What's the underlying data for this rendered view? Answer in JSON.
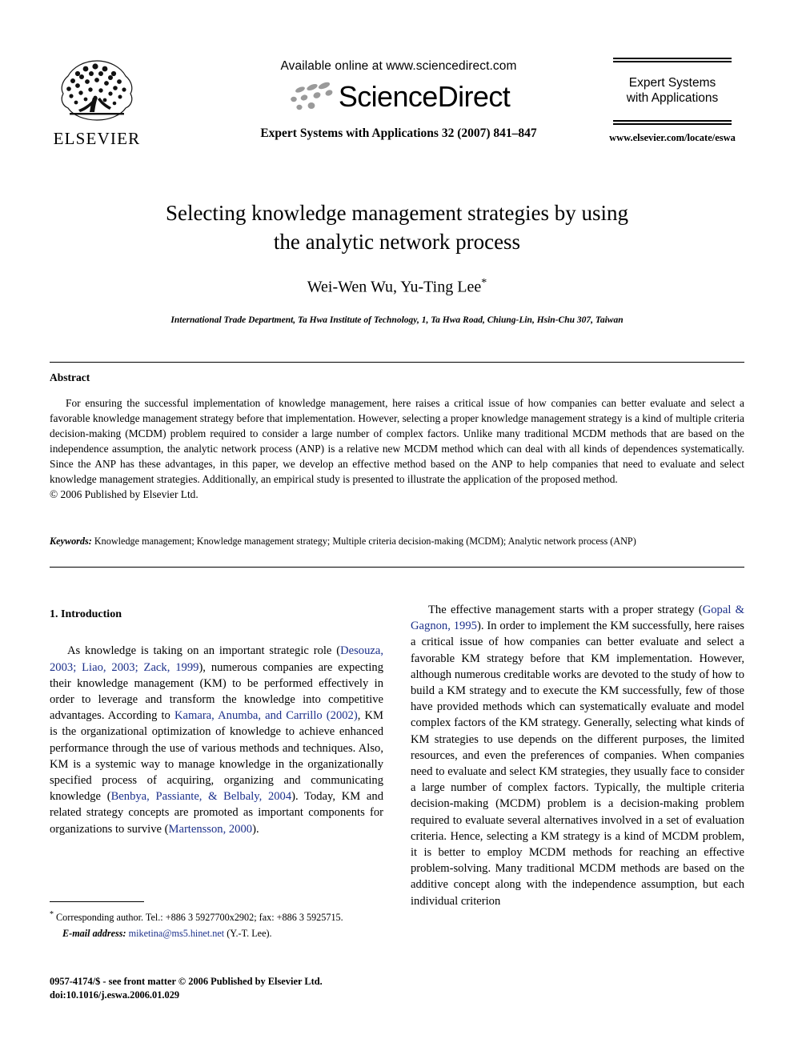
{
  "masthead": {
    "publisher_name": "ELSEVIER",
    "available_online": "Available online at www.sciencedirect.com",
    "sciencedirect_wordmark": "ScienceDirect",
    "journal_reference": "Expert Systems with Applications 32 (2007) 841–847",
    "journal_box": {
      "name_line1": "Expert Systems",
      "name_line2": "with Applications",
      "url": "www.elsevier.com/locate/eswa"
    }
  },
  "title_block": {
    "title_line1": "Selecting knowledge management strategies by using",
    "title_line2": "the analytic network process",
    "authors": "Wei-Wen Wu, Yu-Ting Lee",
    "corresponding_marker": "*",
    "affiliation": "International Trade Department, Ta Hwa Institute of Technology, 1, Ta Hwa Road, Chiung-Lin, Hsin-Chu 307, Taiwan"
  },
  "abstract": {
    "heading": "Abstract",
    "body": "For ensuring the successful implementation of knowledge management, here raises a critical issue of how companies can better evaluate and select a favorable knowledge management strategy before that implementation. However, selecting a proper knowledge management strategy is a kind of multiple criteria decision-making (MCDM) problem required to consider a large number of complex factors. Unlike many traditional MCDM methods that are based on the independence assumption, the analytic network process (ANP) is a relative new MCDM method which can deal with all kinds of dependences systematically. Since the ANP has these advantages, in this paper, we develop an effective method based on the ANP to help companies that need to evaluate and select knowledge management strategies. Additionally, an empirical study is presented to illustrate the application of the proposed method.",
    "copyright": "© 2006 Published by Elsevier Ltd."
  },
  "keywords": {
    "label": "Keywords:",
    "text": "Knowledge management; Knowledge management strategy; Multiple criteria decision-making (MCDM); Analytic network process (ANP)"
  },
  "introduction": {
    "heading": "1. Introduction",
    "left_column": {
      "p1_part1": "As knowledge is taking on an important strategic role (",
      "p1_cite1": "Desouza, 2003; Liao, 2003; Zack, 1999",
      "p1_part2": "), numerous companies are expecting their knowledge management (KM) to be performed effectively in order to leverage and transform the knowledge into competitive advantages. According to ",
      "p1_cite2": "Kamara, Anumba, and Carrillo (2002)",
      "p1_part3": ", KM is the organizational optimization of knowledge to achieve enhanced performance through the use of various methods and techniques. Also, KM is a systemic way to manage knowledge in the organizationally specified process of acquiring, organizing and communicating knowledge (",
      "p1_cite3": "Benbya, Passiante, & Belbaly, 2004",
      "p1_part4": "). Today, KM and related strategy concepts are promoted as important components for organizations to survive (",
      "p1_cite4": "Martensson, 2000",
      "p1_part5": ")."
    },
    "right_column": {
      "p1_part1": "The effective management starts with a proper strategy (",
      "p1_cite1": "Gopal & Gagnon, 1995",
      "p1_part2": "). In order to implement the KM successfully, here raises a critical issue of how companies can better evaluate and select a favorable KM strategy before that KM implementation. However, although numerous creditable works are devoted to the study of how to build a KM strategy and to execute the KM successfully, few of those have provided methods which can systematically evaluate and model complex factors of the KM strategy. Generally, selecting what kinds of KM strategies to use depends on the different purposes, the limited resources, and even the preferences of companies. When companies need to evaluate and select KM strategies, they usually face to consider a large number of complex factors. Typically, the multiple criteria decision-making (MCDM) problem is a decision-making problem required to evaluate several alternatives involved in a set of evaluation criteria. Hence, selecting a KM strategy is a kind of MCDM problem, it is better to employ MCDM methods for reaching an effective problem-solving. Many traditional MCDM methods are based on the additive concept along with the independence assumption, but each individual criterion"
    }
  },
  "footnote": {
    "marker": "*",
    "text": "Corresponding author. Tel.: +886 3 5927700x2902; fax: +886 3 5925715.",
    "email_label": "E-mail address:",
    "email": "miketina@ms5.hinet.net",
    "email_owner": "(Y.-T. Lee)."
  },
  "imprint": {
    "line1": "0957-4174/$ - see front matter © 2006 Published by Elsevier Ltd.",
    "line2": "doi:10.1016/j.eswa.2006.01.029"
  },
  "colors": {
    "citation_blue": "#1b2f8a",
    "text_black": "#000000",
    "page_white": "#ffffff"
  }
}
